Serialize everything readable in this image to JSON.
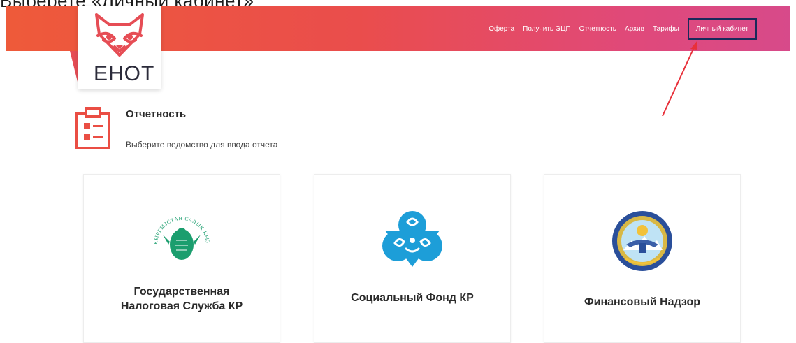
{
  "instruction": "Выберете «Личный кабинет»",
  "header": {
    "brand": "ЕНОТ",
    "nav": [
      "Оферта",
      "Получить ЭЦП",
      "Отчетность",
      "Архив",
      "Тарифы",
      "Личный кабинет"
    ],
    "highlighted_item": "Личный кабинет"
  },
  "section": {
    "title": "Отчетность",
    "subtitle": "Выберите ведомство для ввода отчета",
    "icon": "report-clipboard-icon"
  },
  "cards": [
    {
      "title_line1": "Государственная",
      "title_line2": "Налоговая Служба КР",
      "icon": "tax-service-emblem",
      "emblem_text": "КЫРГЫЗСТАН САЛЫК КЫЗМАТЫ"
    },
    {
      "title_line1": "Социальный Фонд КР",
      "title_line2": "",
      "icon": "social-fund-emblem"
    },
    {
      "title_line1": "Финансовый Надзор",
      "title_line2": "",
      "icon": "kyrgyz-state-emblem"
    }
  ],
  "colors": {
    "header_start": "#ee5a3a",
    "header_end": "#d74a8a",
    "highlight_border": "#1a2a5a",
    "arrow": "#e8303a",
    "accent": "#e64d55"
  }
}
